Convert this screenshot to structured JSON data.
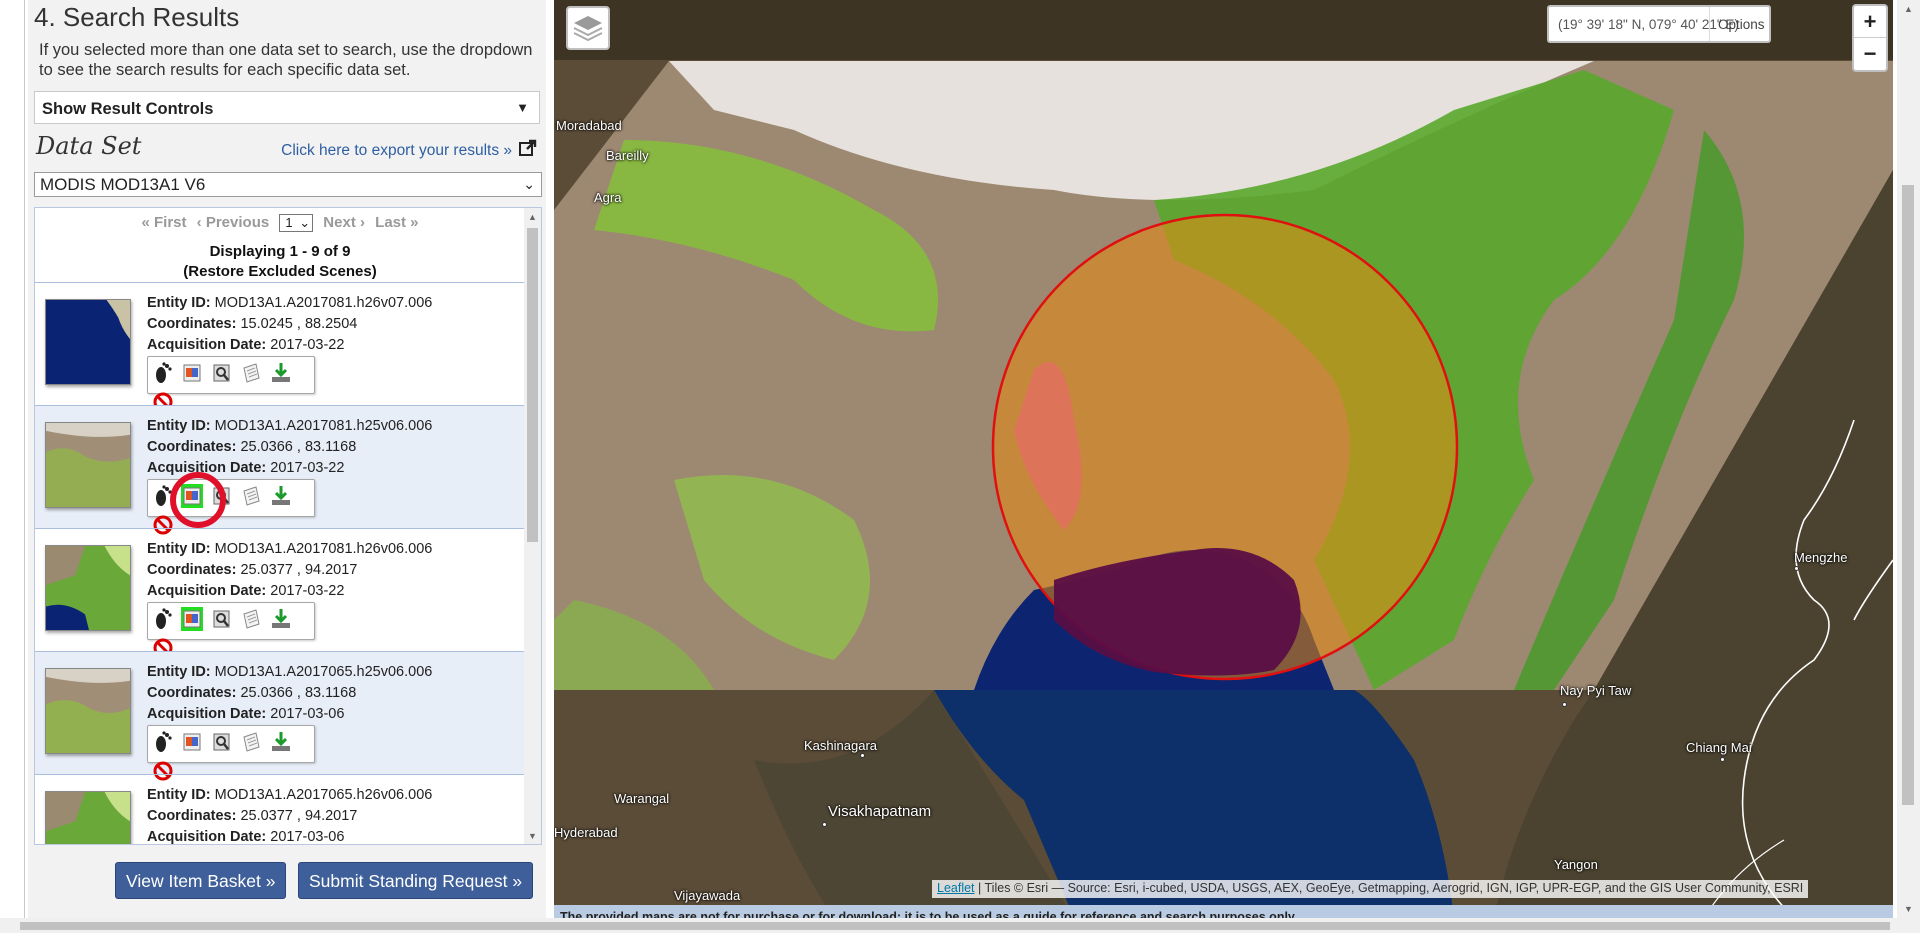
{
  "panel": {
    "title": "4. Search Results",
    "description": "If you selected more than one data set to search, use the dropdown to see the search results for each specific data set.",
    "result_controls_label": "Show Result Controls",
    "dataset_label": "Data Set",
    "export_link": "Click here to export your results »",
    "dataset_selected": "MODIS MOD13A1 V6"
  },
  "pager": {
    "first": "« First",
    "previous": "‹ Previous",
    "page": "1",
    "next": "Next ›",
    "last": "Last »",
    "displaying": "Displaying 1 - 9 of 9",
    "restore": "(Restore Excluded Scenes)"
  },
  "labels": {
    "entity": "Entity ID:",
    "coords": "Coordinates:",
    "acq": "Acquisition Date:"
  },
  "results": [
    {
      "entity_id": "MOD13A1.A2017081.h26v07.006",
      "coordinates": "15.0245 , 88.2504",
      "date": "2017-03-22"
    },
    {
      "entity_id": "MOD13A1.A2017081.h25v06.006",
      "coordinates": "25.0366 , 83.1168",
      "date": "2017-03-22"
    },
    {
      "entity_id": "MOD13A1.A2017081.h26v06.006",
      "coordinates": "25.0377 , 94.2017",
      "date": "2017-03-22"
    },
    {
      "entity_id": "MOD13A1.A2017065.h25v06.006",
      "coordinates": "25.0366 , 83.1168",
      "date": "2017-03-06"
    },
    {
      "entity_id": "MOD13A1.A2017065.h26v06.006",
      "coordinates": "25.0377 , 94.2017",
      "date": "2017-03-06"
    }
  ],
  "buttons": {
    "basket": "View Item Basket »",
    "standing": "Submit Standing Request »"
  },
  "map": {
    "coordinates": "(19° 39' 18\" N, 079° 40' 21\" E)",
    "options": "Options",
    "zoom_in": "+",
    "zoom_out": "−",
    "attribution_link": "Leaflet",
    "attribution": "| Tiles © Esri — Source: Esri, i-cubed, USDA, USGS, AEX, GeoEye, Getmapping, Aerogrid, IGN, IGP, UPR-EGP, and the GIS User Community, ESRI",
    "disclaimer": "The provided maps are not for purchase or for download; it is to be used as a guide for reference and search purposes only.",
    "places": [
      "Moradabad",
      "Bareilly",
      "Agra",
      "Kashinagara",
      "Warangal",
      "Visakhapatnam",
      "Hyderabad",
      "Vijayawada",
      "Nay Pyi Taw",
      "Chiang Mai",
      "Mengzhe",
      "Yangon"
    ]
  },
  "colors": {
    "button_blue": "#3e5f99",
    "link_blue": "#2f5fa3",
    "aoi_red": "#e01010"
  }
}
